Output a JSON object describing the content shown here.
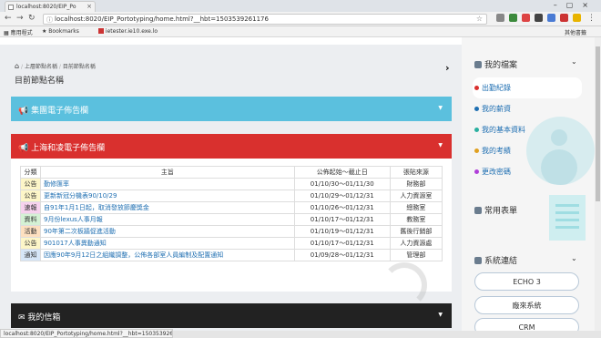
{
  "browser": {
    "tab_title": "localhost:8020/EIP_Po",
    "url": "localhost:8020/EIP_Portotyping/home.html?__hbt=1503539261176",
    "bookmarks": [
      "應用程式",
      "Bookmarks",
      "ietester.ie10.exe.lo"
    ],
    "other_bookmarks": "其他書籤",
    "status_url": "localhost:8020/EIP_Portotyping/home.html?__hbt=1503539261176#"
  },
  "breadcrumb": [
    "上層節點名稱",
    "目前節點名稱"
  ],
  "page_title": "目前節點名稱",
  "panels": {
    "group": "集團電子佈告欄",
    "shanghai": "上海和凌電子佈告欄",
    "mailbox": "我的信箱"
  },
  "table": {
    "headers": [
      "分類",
      "主旨",
      "公佈起始～截止日",
      "張貼來源"
    ],
    "rows": [
      {
        "cat": "公告",
        "cat_color": "#fdf6c8",
        "subject": "勤修匯率",
        "date": "01/10/30～01/11/30",
        "source": "財務部"
      },
      {
        "cat": "公告",
        "cat_color": "#fdf6c8",
        "subject": "更新新冠分機表90/10/29",
        "date": "01/10/29～01/12/31",
        "source": "人力資源室"
      },
      {
        "cat": "速報",
        "cat_color": "#f7d2ee",
        "subject": "自91年1月1日起，取消發放節慶獎金",
        "date": "01/10/26～01/12/31",
        "source": "總務室"
      },
      {
        "cat": "資料",
        "cat_color": "#d4f1d4",
        "subject": "9月份lexus人事月報",
        "date": "01/10/17～01/12/31",
        "source": "教務室"
      },
      {
        "cat": "活動",
        "cat_color": "#fde0c0",
        "subject": "90年第二次板牆促進活動",
        "date": "01/10/19～01/12/31",
        "source": "舊後行銷部"
      },
      {
        "cat": "公告",
        "cat_color": "#fdf6c8",
        "subject": "901017人事異動通知",
        "date": "01/10/17～01/12/31",
        "source": "人力資源處"
      },
      {
        "cat": "通知",
        "cat_color": "#d6e6f7",
        "subject": "因應90年9月12日之組織調整，公佈各部室人員編制及配置通知",
        "date": "01/09/28～01/12/31",
        "source": "管理部"
      }
    ]
  },
  "sidebar": {
    "my_files": "我的檔案",
    "items": [
      {
        "label": "出勤紀錄",
        "color": "#d9302e"
      },
      {
        "label": "我的薪資",
        "color": "#1f6fb2"
      },
      {
        "label": "我的基本資料",
        "color": "#2ab0a0"
      },
      {
        "label": "我的考績",
        "color": "#e0a020"
      },
      {
        "label": "更改密碼",
        "color": "#b03fd9"
      }
    ],
    "forms": "常用表單",
    "links_title": "系統連結",
    "links": [
      "ECHO 3",
      "廠來系統",
      "CRM"
    ]
  }
}
